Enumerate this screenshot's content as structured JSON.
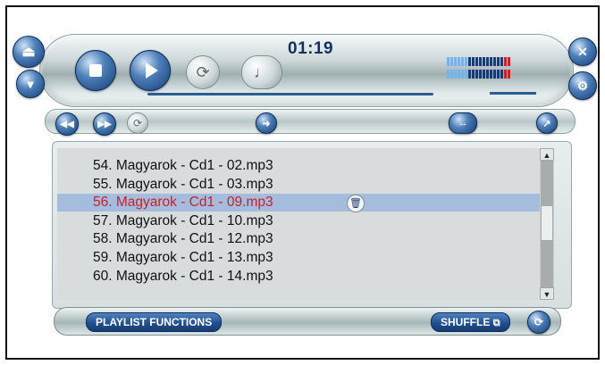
{
  "player": {
    "time": "01:19",
    "colors": {
      "accent": "#1f4c8c",
      "selected_bg": "#a6bcdc",
      "selected_text": "#c6222a"
    },
    "icons": [
      "eject-icon",
      "minimize-icon",
      "close-icon",
      "settings-icon",
      "stop-icon",
      "play-icon",
      "repeat-icon",
      "note-icon",
      "rewind-icon",
      "fast-forward-icon",
      "refresh-icon",
      "seek-handle-icon",
      "balance-icon",
      "volume-icon"
    ]
  },
  "playlist": {
    "items": [
      {
        "number": "54.",
        "title": "Magyarok - Cd1 - 02.mp3"
      },
      {
        "number": "55.",
        "title": "Magyarok - Cd1 - 03.mp3"
      },
      {
        "number": "56.",
        "title": "Magyarok - Cd1 - 09.mp3"
      },
      {
        "number": "57.",
        "title": "Magyarok - Cd1 - 10.mp3"
      },
      {
        "number": "58.",
        "title": "Magyarok - Cd1 - 12.mp3"
      },
      {
        "number": "59.",
        "title": "Magyarok - Cd1 - 13.mp3"
      },
      {
        "number": "60.",
        "title": "Magyarok - Cd1 - 14.mp3"
      }
    ],
    "selected_index": 2,
    "functions_label": "PLAYLIST FUNCTIONS",
    "shuffle_label": "SHUFFLE"
  }
}
